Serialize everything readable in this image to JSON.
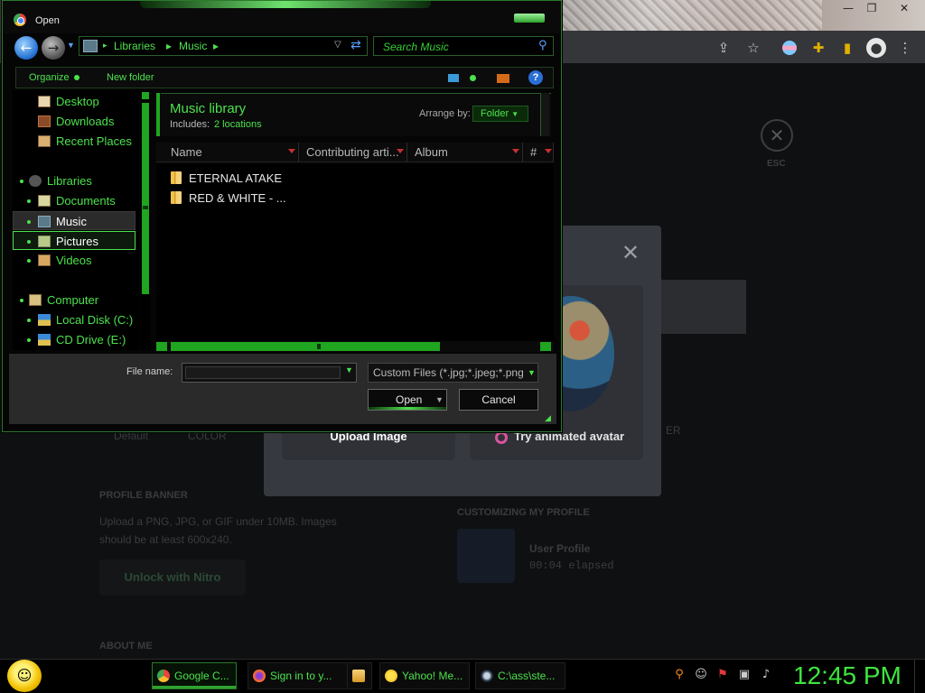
{
  "dialog": {
    "title": "Open",
    "address": {
      "crumbs": [
        "Libraries",
        "Music"
      ]
    },
    "search_placeholder": "Search Music",
    "command_bar": {
      "organize": "Organize",
      "new_folder": "New folder"
    },
    "nav_pane": {
      "items": [
        {
          "label": "Desktop",
          "icon": "desktop-icon"
        },
        {
          "label": "Downloads",
          "icon": "downloads-icon"
        },
        {
          "label": "Recent Places",
          "icon": "recent-places-icon"
        },
        {
          "label": "Libraries",
          "icon": "libraries-icon"
        },
        {
          "label": "Documents",
          "icon": "documents-icon"
        },
        {
          "label": "Music",
          "icon": "music-icon",
          "state": "selected"
        },
        {
          "label": "Pictures",
          "icon": "pictures-icon",
          "state": "hover"
        },
        {
          "label": "Videos",
          "icon": "videos-icon"
        },
        {
          "label": "Computer",
          "icon": "computer-icon"
        },
        {
          "label": "Local Disk (C:)",
          "icon": "disk-icon"
        },
        {
          "label": "CD Drive (E:)",
          "icon": "cd-drive-icon"
        }
      ]
    },
    "library": {
      "title": "Music library",
      "includes_label": "Includes:",
      "includes_link": "2 locations",
      "arrange_label": "Arrange by:",
      "arrange_value": "Folder"
    },
    "columns": [
      "Name",
      "Contributing arti...",
      "Album",
      "#"
    ],
    "files": [
      "ETERNAL ATAKE",
      "RED & WHITE - ..."
    ],
    "filename_label": "File name:",
    "filename_value": "",
    "filetype": "Custom Files (*.jpg;*.jpeg;*.png",
    "open_label": "Open",
    "cancel_label": "Cancel"
  },
  "background_page": {
    "esc_label": "ESC",
    "upload_image": "Upload Image",
    "animated_avatar": "Try animated avatar",
    "default_label": "Default",
    "color_label": "COLOR",
    "er_label": "ER",
    "profile_banner": "PROFILE BANNER",
    "banner_desc": "Upload a PNG, JPG, or GIF under 10MB. Images should be at least 600x240.",
    "nitro_button": "Unlock with Nitro",
    "customizing": "CUSTOMIZING MY PROFILE",
    "user_profile": "User Profile",
    "elapsed": "00:04 elapsed",
    "about_me": "ABOUT ME"
  },
  "taskbar": {
    "items": [
      {
        "label": "Google C...",
        "active": true,
        "icon": "chrome-icon"
      },
      {
        "label": "Sign in to y...",
        "active": false,
        "icon": "firefox-icon"
      },
      {
        "label": "",
        "active": false,
        "icon": "folder-icon"
      },
      {
        "label": "Yahoo! Me...",
        "active": false,
        "icon": "yahoo-messenger-icon"
      },
      {
        "label": "C:\\ass\\ste...",
        "active": false,
        "icon": "steam-icon"
      }
    ],
    "clock": "12:45 PM"
  },
  "colors": {
    "accent_green": "#4ce24c",
    "dialog_bg": "#050505",
    "taskbar_bg": "#000000",
    "clock_green": "#3ee63e"
  }
}
